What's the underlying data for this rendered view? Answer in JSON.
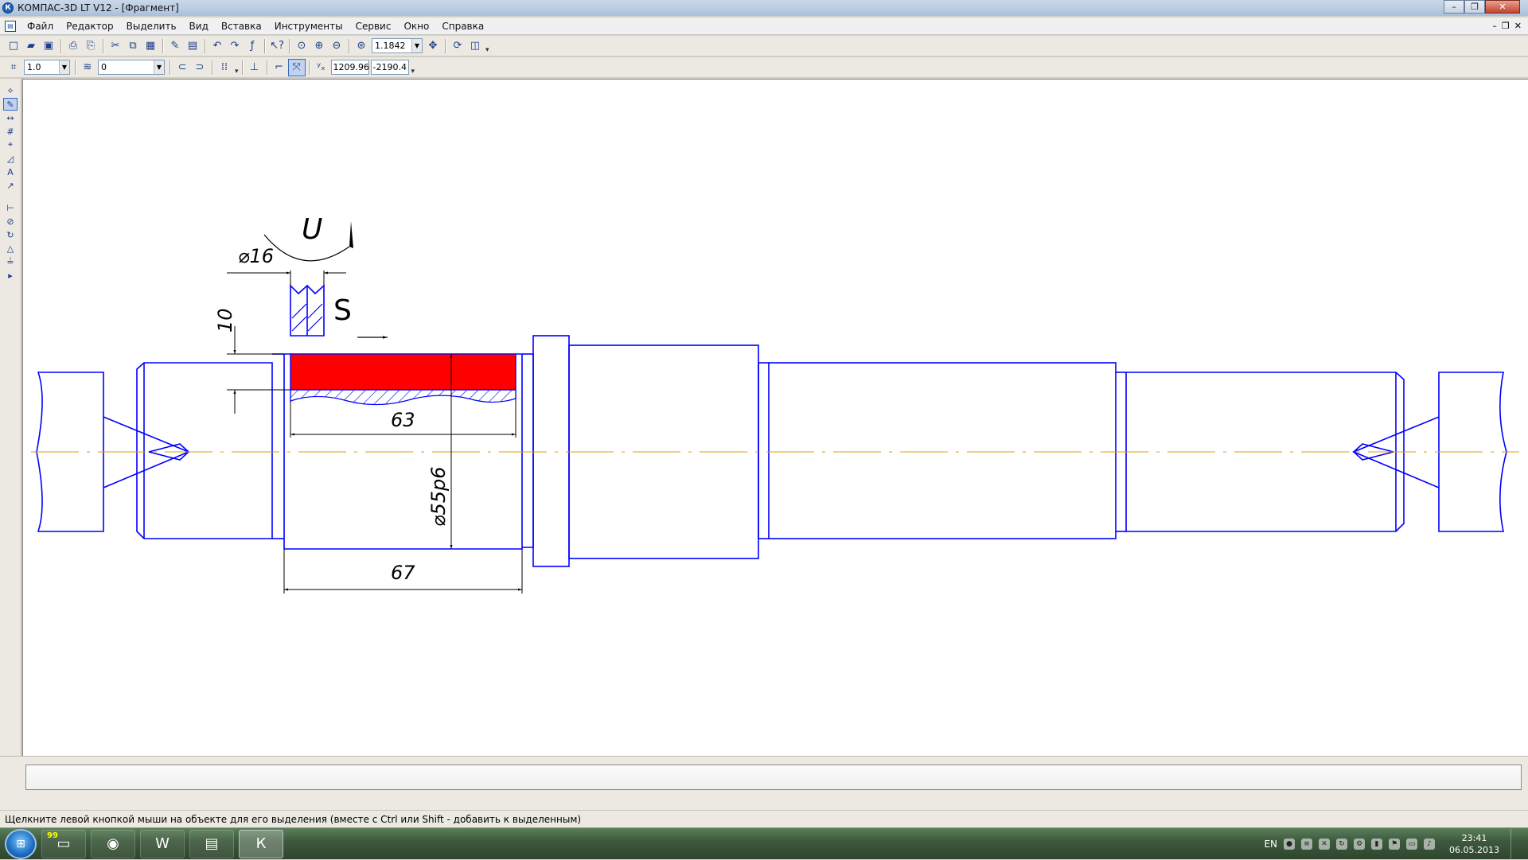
{
  "window": {
    "title": "КОМПАС-3D LT V12 - [Фрагмент]",
    "app_icon": "kompas-logo-icon",
    "controls": {
      "minimize": "–",
      "maximize": "❐",
      "close": "✕"
    }
  },
  "menu": {
    "items": [
      "Файл",
      "Редактор",
      "Выделить",
      "Вид",
      "Вставка",
      "Инструменты",
      "Сервис",
      "Окно",
      "Справка"
    ],
    "mdi": {
      "minimize": "–",
      "restore": "❐",
      "close": "✕"
    }
  },
  "toolbar1": {
    "icons": [
      "new-document-icon",
      "open-folder-icon",
      "save-icon",
      "print-preview-icon",
      "print-icon",
      "cut-icon",
      "copy-icon",
      "paste-icon",
      "properties-icon",
      "manager-icon",
      "undo-icon",
      "redo-icon",
      "formula-icon",
      "help-pointer-icon",
      "zoom-window-icon",
      "zoom-in-icon",
      "zoom-out-icon",
      "zoom-scale-icon",
      "pan-icon",
      "refresh-icon",
      "view-icon"
    ],
    "zoom_value": "1.1842"
  },
  "toolbar2": {
    "step_value": "1.0",
    "layer_value": "0",
    "coord_x": "1209.96",
    "coord_y": "-2190.4"
  },
  "left_panel": {
    "icons": [
      "geometry-icon",
      "edit-icon",
      "dimensions-icon",
      "hatch-icon",
      "designations-icon",
      "measure-icon",
      "text-icon",
      "select-icon",
      "spec-icon",
      "parametrize-icon",
      "constraint-icon",
      "fragment-icon",
      "library-icon",
      "expand-icon"
    ]
  },
  "drawing": {
    "labels": {
      "u": "U",
      "s": "S",
      "d16": "⌀16",
      "d55": "⌀55р6",
      "l10": "10",
      "l63": "63",
      "l67": "67"
    },
    "colors": {
      "outline": "#0000ff",
      "axis": "#e0a000",
      "highlight": "#ff0000",
      "dimension": "#000000"
    }
  },
  "status": {
    "text": "Щелкните левой кнопкой мыши на объекте для его выделения (вместе с Ctrl или Shift - добавить к выделенным)"
  },
  "taskbar": {
    "tasks": [
      "start-orb-icon",
      "explorer-icon",
      "chrome-icon",
      "word-icon",
      "file-manager-icon",
      "kompas-icon"
    ],
    "badge": "99",
    "lang": "EN",
    "time": "23:41",
    "date": "06.05.2013"
  }
}
